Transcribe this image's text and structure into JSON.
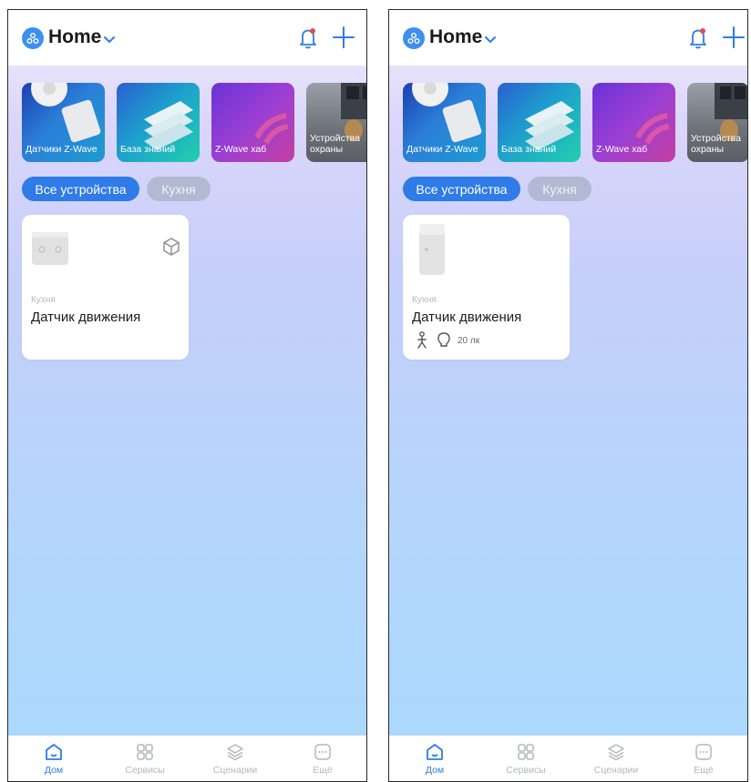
{
  "colors": {
    "accent": "#2f7be8",
    "inactive_chip": "#b1bad2",
    "bell_dot": "#e84b4b"
  },
  "screens": [
    {
      "header": {
        "title": "Home"
      },
      "banners": [
        {
          "label": "Датчики Z-Wave"
        },
        {
          "label": "База знаний"
        },
        {
          "label": "Z-Wave хаб"
        },
        {
          "label": "Устройства охраны"
        }
      ],
      "filters": {
        "active": "Все устройства",
        "inactive": "Кухня"
      },
      "device": {
        "room": "Кухня",
        "name": "Датчик движения",
        "lux": ""
      },
      "tabs": [
        {
          "label": "Дом"
        },
        {
          "label": "Сервисы"
        },
        {
          "label": "Сценарии"
        },
        {
          "label": "Ещё"
        }
      ]
    },
    {
      "header": {
        "title": "Home"
      },
      "banners": [
        {
          "label": "Датчики Z-Wave"
        },
        {
          "label": "База знаний"
        },
        {
          "label": "Z-Wave хаб"
        },
        {
          "label": "Устройства охраны"
        }
      ],
      "filters": {
        "active": "Все устройства",
        "inactive": "Кухня"
      },
      "device": {
        "room": "Кухня",
        "name": "Датчик движения",
        "lux": "20 лк"
      },
      "tabs": [
        {
          "label": "Дом"
        },
        {
          "label": "Сервисы"
        },
        {
          "label": "Сценарии"
        },
        {
          "label": "Ещё"
        }
      ]
    }
  ]
}
